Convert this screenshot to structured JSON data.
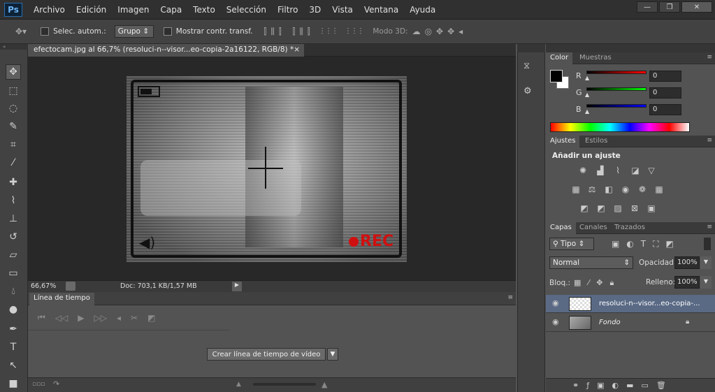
{
  "app": {
    "logo": "Ps"
  },
  "menu": [
    "Archivo",
    "Edición",
    "Imagen",
    "Capa",
    "Texto",
    "Selección",
    "Filtro",
    "3D",
    "Vista",
    "Ventana",
    "Ayuda"
  ],
  "window_buttons": {
    "minimize": "—",
    "restore": "❐",
    "close": "✕"
  },
  "options": {
    "auto_select_label": "Selec. autom.:",
    "auto_select_value": "Grupo",
    "show_transform_label": "Mostrar contr. transf.",
    "mode_3d_label": "Modo 3D:"
  },
  "document": {
    "tab_title": "efectocam.jpg al 66,7% (resoluci-n--visor...eo-copia-2a16122, RGB/8) *",
    "close": "×",
    "canvas_overlay_text": "REC"
  },
  "status": {
    "zoom": "66,67%",
    "doc_info": "Doc: 703,1 KB/1,57 MB"
  },
  "timeline": {
    "tab": "Línea de tiempo",
    "create_button": "Crear línea de tiempo de vídeo"
  },
  "color_panel": {
    "tabs": [
      "Color",
      "Muestras"
    ],
    "channels": [
      {
        "label": "R",
        "value": "0"
      },
      {
        "label": "G",
        "value": "0"
      },
      {
        "label": "B",
        "value": "0"
      }
    ]
  },
  "adjust_panel": {
    "tabs": [
      "Ajustes",
      "Estilos"
    ],
    "heading": "Añadir un ajuste"
  },
  "layers_panel": {
    "tabs": [
      "Capas",
      "Canales",
      "Trazados"
    ],
    "filter_label": "Tipo",
    "blend_mode": "Normal",
    "opacity_label": "Opacidad:",
    "opacity_value": "100%",
    "lock_label": "Bloq.:",
    "fill_label": "Relleno:",
    "fill_value": "100%",
    "layers": [
      {
        "name": "resoluci-n--visor...eo-copia-...",
        "selected": true
      },
      {
        "name": "Fondo",
        "selected": false
      }
    ]
  },
  "colors": {
    "accent": "#5a6a85",
    "rec": "#d01010"
  }
}
